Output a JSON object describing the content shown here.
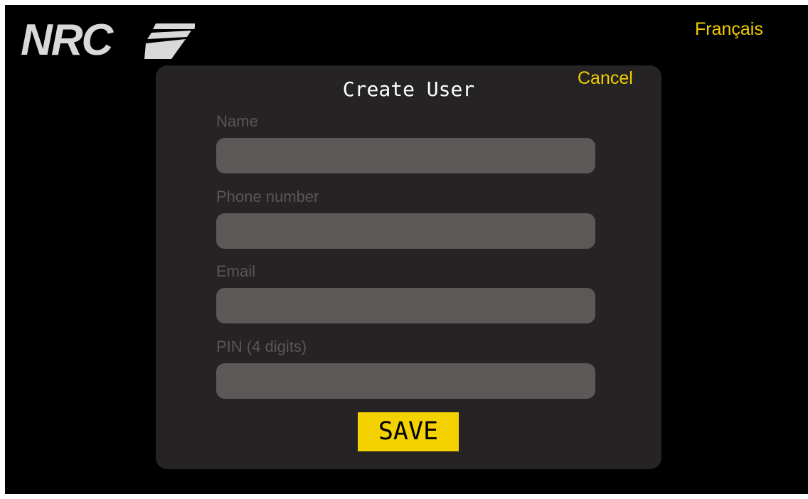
{
  "header": {
    "logo_text": "NRC",
    "language_link": "Français"
  },
  "dialog": {
    "title": "Create User",
    "cancel_label": "Cancel",
    "fields": [
      {
        "label": "Name",
        "value": ""
      },
      {
        "label": "Phone number",
        "value": ""
      },
      {
        "label": "Email",
        "value": ""
      },
      {
        "label": "PIN (4 digits)",
        "value": ""
      }
    ],
    "save_label": "SAVE"
  },
  "colors": {
    "accent": "#f2cd00",
    "background": "#000000",
    "dialog_background": "#252323",
    "input_background": "#5d5858",
    "label_text": "#5a5656"
  }
}
